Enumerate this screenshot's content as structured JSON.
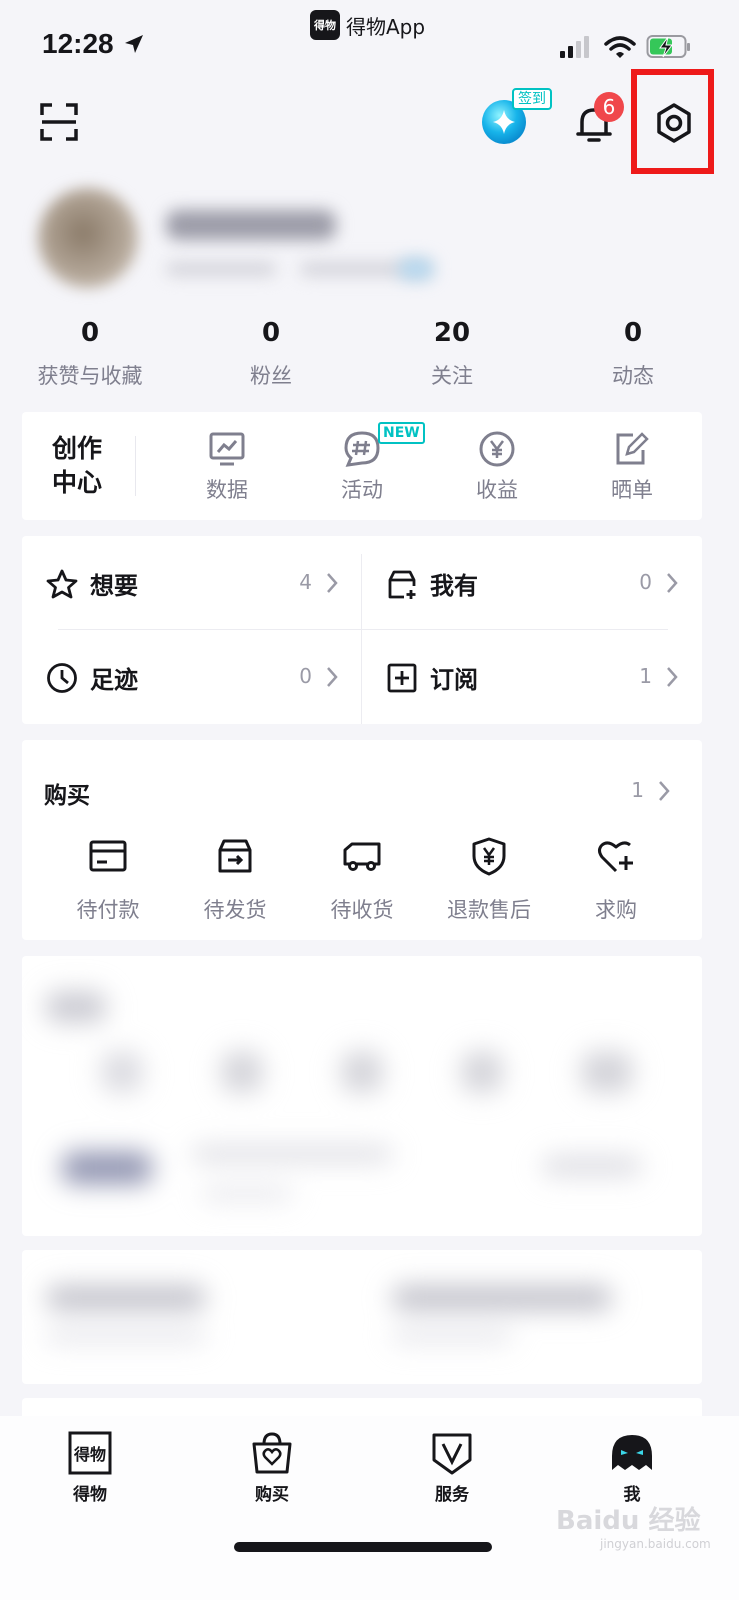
{
  "status_bar": {
    "time": "12:28",
    "app_name": "得物App",
    "app_logo": "得物"
  },
  "header": {
    "checkin_label": "签到",
    "notification_count": "6"
  },
  "stats": [
    {
      "value": "0",
      "label": "获赞与收藏"
    },
    {
      "value": "0",
      "label": "粉丝"
    },
    {
      "value": "20",
      "label": "关注"
    },
    {
      "value": "0",
      "label": "动态"
    }
  ],
  "creator": {
    "title_line1": "创作",
    "title_line2": "中心",
    "new_tag": "NEW",
    "items": [
      {
        "label": "数据",
        "icon": "monitor-chart-icon"
      },
      {
        "label": "活动",
        "icon": "hashtag-bubble-icon"
      },
      {
        "label": "收益",
        "icon": "yen-coin-icon"
      },
      {
        "label": "晒单",
        "icon": "edit-note-icon"
      }
    ]
  },
  "collections": [
    {
      "label": "想要",
      "count": "4",
      "icon": "star-icon"
    },
    {
      "label": "我有",
      "count": "0",
      "icon": "box-plus-icon"
    },
    {
      "label": "足迹",
      "count": "0",
      "icon": "clock-icon"
    },
    {
      "label": "订阅",
      "count": "1",
      "icon": "square-plus-icon"
    }
  ],
  "purchase": {
    "title": "购买",
    "count": "1",
    "items": [
      {
        "label": "待付款",
        "icon": "card-icon"
      },
      {
        "label": "待发货",
        "icon": "box-arrow-icon"
      },
      {
        "label": "待收货",
        "icon": "truck-icon"
      },
      {
        "label": "退款售后",
        "icon": "shield-yen-icon"
      },
      {
        "label": "求购",
        "icon": "heart-plus-icon"
      }
    ]
  },
  "tabbar": [
    {
      "label": "得物",
      "icon": "dewu-logo-icon"
    },
    {
      "label": "购买",
      "icon": "shopping-bag-icon"
    },
    {
      "label": "服务",
      "icon": "v-shield-icon"
    },
    {
      "label": "我",
      "icon": "ghost-avatar-icon"
    }
  ],
  "watermark": {
    "text": "Baidu 经验",
    "sub": "jingyan.baidu.com"
  },
  "colors": {
    "accent": "#01c2c3",
    "badge": "#f0474b",
    "highlight": "#ee1a1a"
  }
}
